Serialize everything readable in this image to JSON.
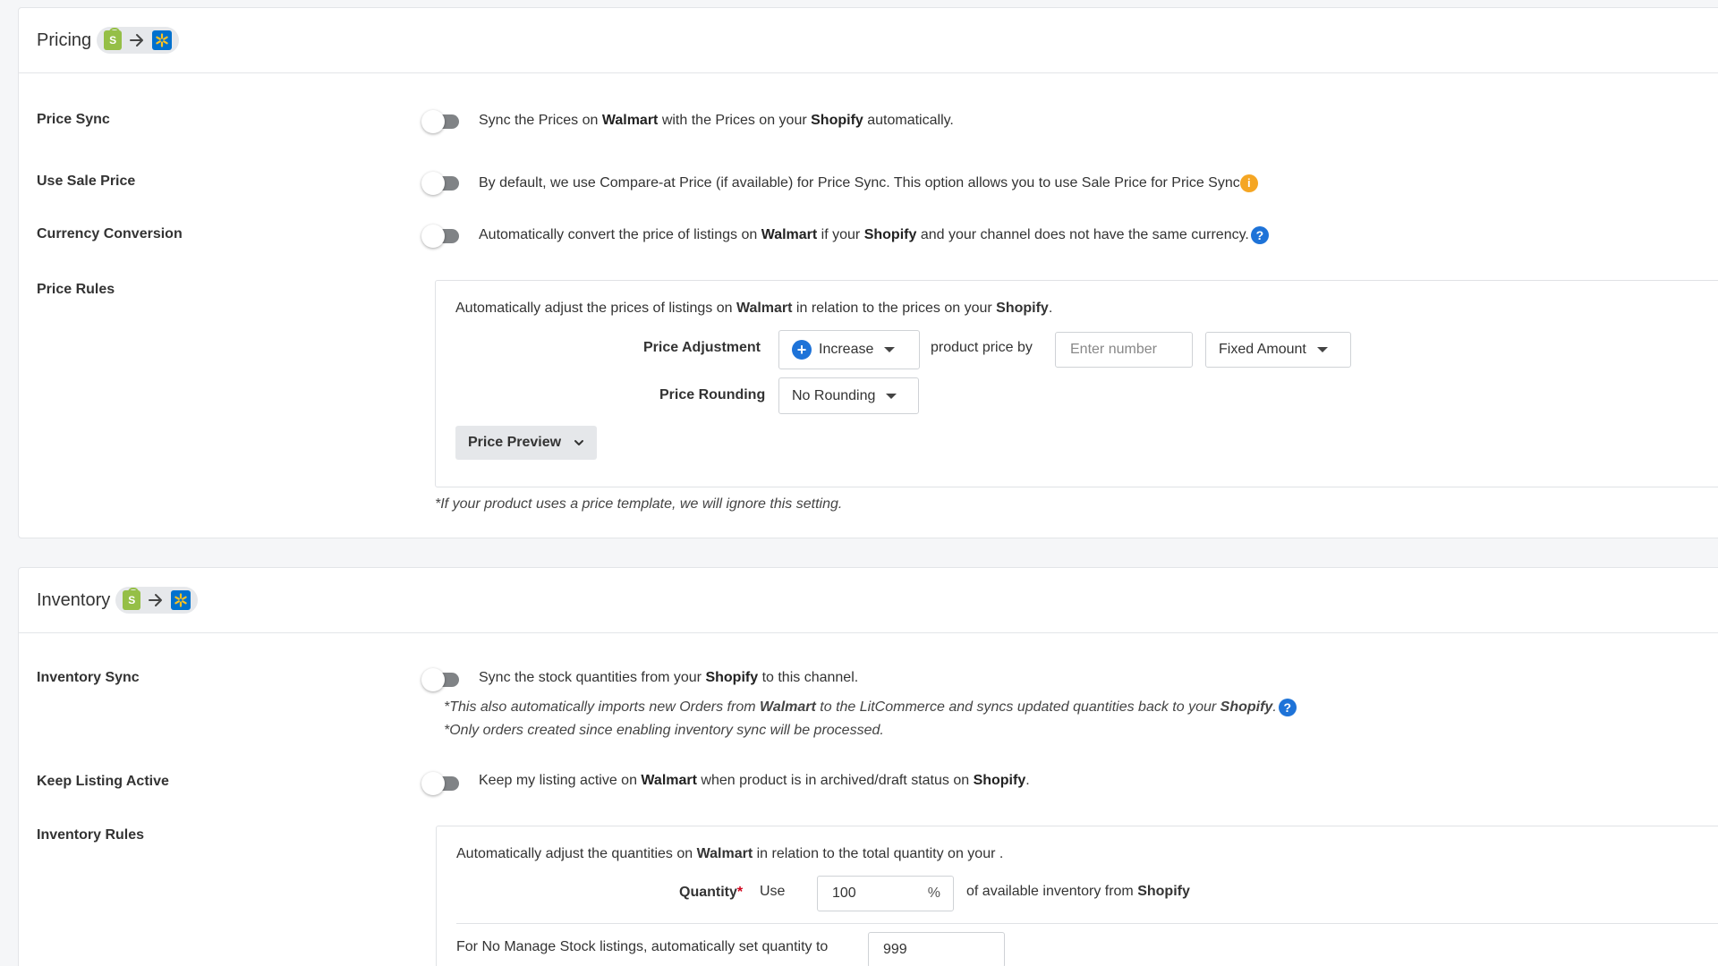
{
  "pricing": {
    "title": "Pricing",
    "price_sync": {
      "label": "Price Sync",
      "text_1": "Sync the Prices on ",
      "walmart": "Walmart",
      "text_2": " with the Prices on your ",
      "shopify": "Shopify",
      "text_3": " automatically."
    },
    "use_sale_price": {
      "label": "Use Sale Price",
      "text": "By default, we use Compare-at Price (if available) for Price Sync. This option allows you to use Sale Price for Price Sync"
    },
    "currency_conversion": {
      "label": "Currency Conversion",
      "text_1": "Automatically convert the price of listings on ",
      "walmart": "Walmart",
      "text_2": " if your ",
      "shopify": "Shopify",
      "text_3": " and your channel does not have the same currency."
    },
    "price_rules": {
      "label": "Price Rules",
      "intro_1": "Automatically adjust the prices of listings on ",
      "walmart": "Walmart",
      "intro_2": " in relation to the prices on your ",
      "shopify": "Shopify",
      "intro_3": ".",
      "adjustment_label": "Price Adjustment",
      "adjustment_value": "Increase",
      "product_price_by": "product price by",
      "amount_placeholder": "Enter number",
      "amount_type": "Fixed Amount",
      "rounding_label": "Price Rounding",
      "rounding_value": "No Rounding",
      "preview_button": "Price Preview",
      "footnote": "*If your product uses a price template, we will ignore this setting."
    }
  },
  "inventory": {
    "title": "Inventory",
    "inventory_sync": {
      "label": "Inventory Sync",
      "text_1": "Sync the stock quantities from your ",
      "shopify": "Shopify",
      "text_2": " to this channel.",
      "note1_1": "*This also automatically imports new Orders from ",
      "note1_walmart": "Walmart",
      "note1_2": " to the LitCommerce and syncs updated quantities back to your ",
      "note1_shopify": "Shopify",
      "note1_3": ".",
      "note2": "*Only orders created since enabling inventory sync will be processed."
    },
    "keep_listing_active": {
      "label": "Keep Listing Active",
      "text_1": "Keep my listing active on ",
      "walmart": "Walmart",
      "text_2": " when product is in archived/draft status on ",
      "shopify": "Shopify",
      "text_3": "."
    },
    "inventory_rules": {
      "label": "Inventory Rules",
      "intro_1": "Automatically adjust the quantities on ",
      "walmart": "Walmart",
      "intro_2": " in relation to the total quantity on your .",
      "quantity_label": "Quantity",
      "required_mark": "*",
      "use_label": "Use",
      "quantity_value": "100",
      "percent": "%",
      "available_text": "of available inventory from ",
      "shopify": "Shopify",
      "no_manage_text": "For No Manage Stock listings, automatically set quantity to",
      "no_manage_value": "999"
    }
  },
  "icons": {
    "help": "?",
    "info": "i",
    "plus": "+",
    "shopify_letter": "S"
  },
  "colors": {
    "accent_blue": "#1e73d8",
    "shopify_green": "#95bf47",
    "walmart_blue": "#0071ce",
    "info_orange": "#f5a623"
  }
}
